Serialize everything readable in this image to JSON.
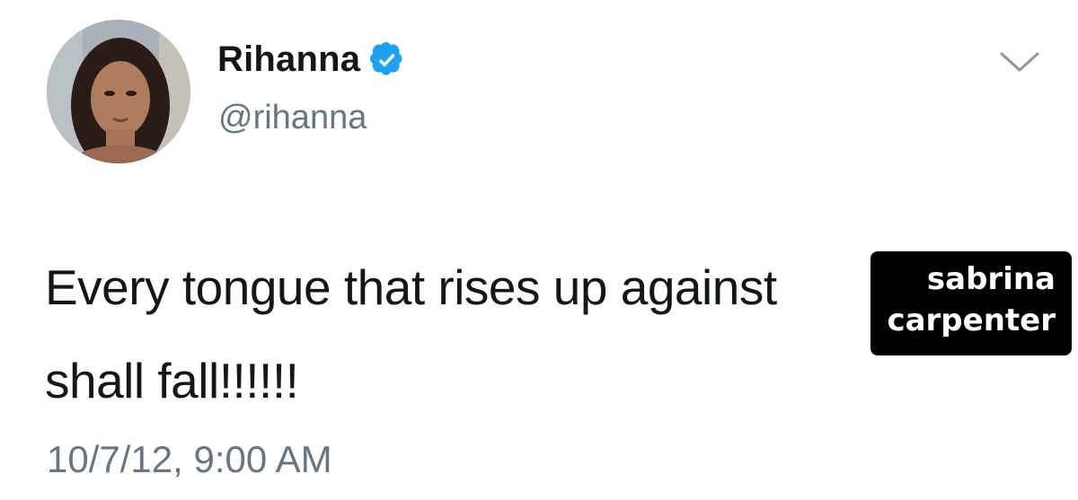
{
  "tweet": {
    "author": {
      "display_name": "Rihanna",
      "handle": "@rihanna",
      "verified": true,
      "avatar_icon": "profile-photo-avatar"
    },
    "menu_icon": "chevron-down-icon",
    "text_lines": [
      "Every tongue that rises up against",
      "shall fall!!!!!!"
    ],
    "timestamp": "10/7/12, 9:00 AM"
  },
  "overlay": {
    "lines": [
      "sabrina",
      "carpenter"
    ]
  },
  "colors": {
    "verified_blue": "#1da1f2",
    "secondary_text": "#657786",
    "primary_text": "#14171a",
    "overlay_bg": "#000000"
  }
}
